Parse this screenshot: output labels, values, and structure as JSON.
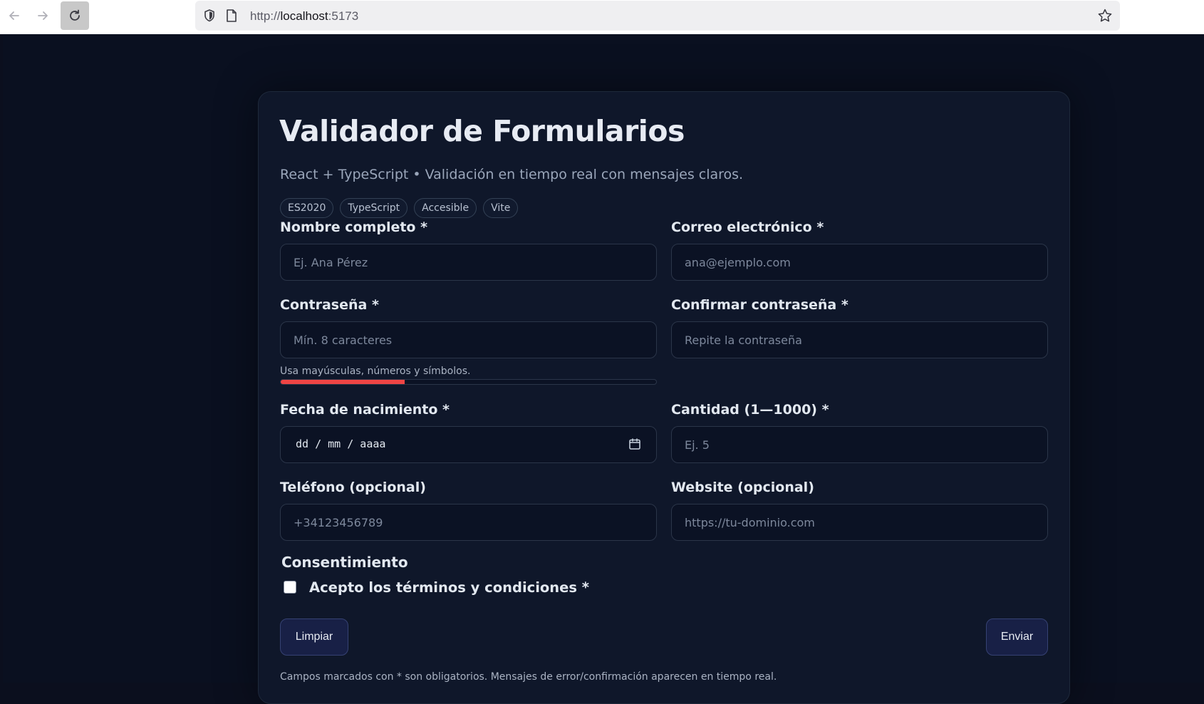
{
  "browser": {
    "url_prefix": "http://",
    "url_host": "localhost",
    "url_port": ":5173"
  },
  "header": {
    "title": "Validador de Formularios",
    "subtitle": "React + TypeScript • Validación en tiempo real con mensajes claros.",
    "tags": [
      "ES2020",
      "TypeScript",
      "Accesible",
      "Vite"
    ]
  },
  "form": {
    "name": {
      "label": "Nombre completo *",
      "placeholder": "Ej. Ana Pérez",
      "value": ""
    },
    "email": {
      "label": "Correo electrónico *",
      "placeholder": "ana@ejemplo.com",
      "value": ""
    },
    "password": {
      "label": "Contraseña *",
      "placeholder": "Mín. 8 caracteres",
      "value": "",
      "hint": "Usa mayúsculas, números y símbolos.",
      "strength_fraction": 0.33
    },
    "confirm": {
      "label": "Confirmar contraseña *",
      "placeholder": "Repite la contraseña",
      "value": ""
    },
    "birthdate": {
      "label": "Fecha de nacimiento *",
      "placeholder": "dd / mm / aaaa"
    },
    "quantity": {
      "label": "Cantidad (1—1000) *",
      "placeholder": "Ej. 5",
      "value": ""
    },
    "phone": {
      "label": "Teléfono (opcional)",
      "placeholder": "+34123456789",
      "value": ""
    },
    "website": {
      "label": "Website (opcional)",
      "placeholder": "https://tu-dominio.com",
      "value": ""
    },
    "consent": {
      "section": "Consentimiento",
      "label": "Acepto los términos y condiciones *",
      "checked": false
    },
    "clear_label": "Limpiar",
    "submit_label": "Enviar",
    "footnote": "Campos marcados con * son obligatorios. Mensajes de error/confirmación aparecen en tiempo real."
  },
  "colors": {
    "background": "#0a1020",
    "card": "#0f172a",
    "strength_weak": "#ef4444"
  }
}
